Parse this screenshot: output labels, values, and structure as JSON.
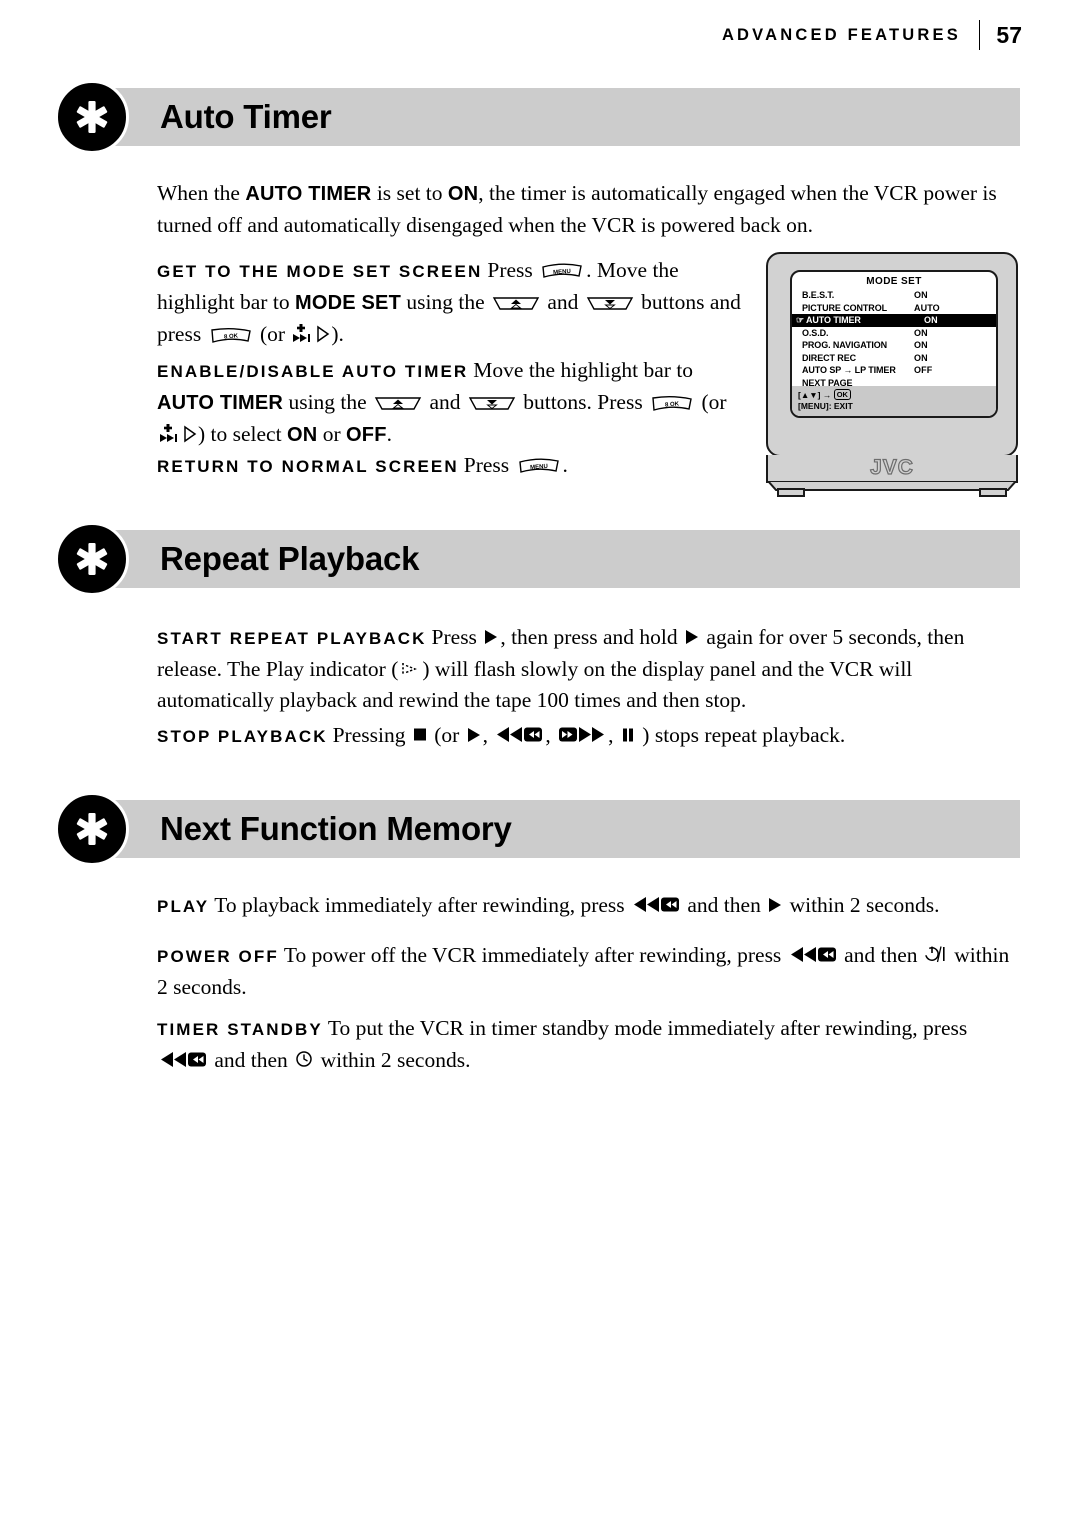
{
  "header": {
    "title": "ADVANCED FEATURES",
    "page_number": "57"
  },
  "sections": [
    {
      "id": "auto-timer",
      "title": "Auto Timer",
      "icon": "star-badge-icon"
    },
    {
      "id": "repeat-playback",
      "title": "Repeat Playback",
      "icon": "star-badge-icon"
    },
    {
      "id": "next-function-memory",
      "title": "Next Function Memory",
      "icon": "star-badge-icon"
    }
  ],
  "auto_timer": {
    "intro": {
      "t1": "When the ",
      "b1": "AUTO TIMER",
      "t2": " is set to ",
      "b2": "ON",
      "t3": ", the timer is automatically engaged when the VCR power is turned off and automatically disengaged when the VCR is powered back on."
    },
    "step1": {
      "runin": "GET TO THE MODE SET SCREEN",
      "t1": "Press ",
      "key1": "MENU",
      "t2": ". Move the highlight bar to ",
      "b1": "MODE SET",
      "t3": " using the ",
      "key2": "up-arrow",
      "t4": " and ",
      "key3": "down-arrow",
      "t5": " buttons and press ",
      "key4": "8 OK",
      "t6": " (or ",
      "key5": "skip-forward-plus",
      "key6": "right-triangle-outline",
      "t7": ")."
    },
    "step2": {
      "runin": "ENABLE/DISABLE AUTO TIMER",
      "t1": "Move the highlight bar to ",
      "b1": "AUTO TIMER",
      "t2": " using the ",
      "key1": "up-arrow",
      "t3": " and ",
      "key2": "down-arrow",
      "t4": " buttons. Press ",
      "key3": "8 OK",
      "t5": " (or ",
      "key4": "skip-forward-plus",
      "key5": "right-triangle-outline",
      "t6": ") to select ",
      "b2": "ON",
      "t7": " or ",
      "b3": "OFF",
      "t8": "."
    },
    "step3": {
      "runin": "RETURN TO NORMAL SCREEN",
      "t1": "Press ",
      "key1": "MENU",
      "t2": "."
    }
  },
  "tv_osd": {
    "title": "MODE SET",
    "rows": [
      {
        "label": "B.E.S.T.",
        "value": "ON",
        "highlighted": false,
        "cursor": ""
      },
      {
        "label": "PICTURE CONTROL",
        "value": "AUTO",
        "highlighted": false,
        "cursor": ""
      },
      {
        "label": "AUTO TIMER",
        "value": "ON",
        "highlighted": true,
        "cursor": "☞"
      },
      {
        "label": "O.S.D.",
        "value": "ON",
        "highlighted": false,
        "cursor": ""
      },
      {
        "label": "PROG. NAVIGATION",
        "value": "ON",
        "highlighted": false,
        "cursor": ""
      },
      {
        "label": "DIRECT REC",
        "value": "ON",
        "highlighted": false,
        "cursor": ""
      },
      {
        "label": "AUTO SP → LP TIMER",
        "value": "OFF",
        "highlighted": false,
        "cursor": ""
      },
      {
        "label": "NEXT PAGE",
        "value": "",
        "highlighted": false,
        "cursor": ""
      }
    ],
    "footer_line1_prefix": "[▲▼] → ",
    "footer_line1_ok": "OK",
    "footer_line2": "[MENU]: EXIT",
    "brand": "JVC"
  },
  "repeat_playback": {
    "p1": {
      "runin": "START REPEAT PLAYBACK",
      "t1": "Press ",
      "key1": "play",
      "t2": ", then press and hold ",
      "key2": "play",
      "t3": " again for over 5 seconds, then release. The Play indicator (",
      "key3": "play-indicator-outline",
      "t4": ") will flash slowly on the display panel and the VCR will automatically playback and rewind the tape 100 times and then stop."
    },
    "p2": {
      "runin": "STOP PLAYBACK",
      "t1": "Pressing ",
      "key1": "stop",
      "t2": " (or ",
      "key2": "play",
      "t3": ", ",
      "key3": "rewind",
      "t4": ", ",
      "key4": "fast-forward",
      "t5": ", ",
      "key5": "pause",
      "t6": " ) stops repeat playback."
    }
  },
  "next_function_memory": {
    "p1": {
      "runin": "PLAY",
      "t1": "To playback immediately after rewinding, press ",
      "key1": "rewind",
      "t2": " and then ",
      "key2": "play",
      "t3": " within 2 seconds."
    },
    "p2": {
      "runin": "POWER OFF",
      "t1": "To power off the VCR immediately after rewinding, press ",
      "key1": "rewind",
      "t2": " and then ",
      "key2": "power",
      "t3": " within 2 seconds."
    },
    "p3": {
      "runin": "TIMER STANDBY",
      "t1": "To put the VCR in timer standby mode immediately after rewinding, press ",
      "key1": "rewind",
      "t2": " and then ",
      "key2": "timer-clock",
      "t3": " within 2 seconds."
    }
  },
  "colors": {
    "band": "#cccccc",
    "badge": "#000000",
    "tv_body": "#d2d2d2",
    "osd_footer": "#c9c9c9"
  }
}
